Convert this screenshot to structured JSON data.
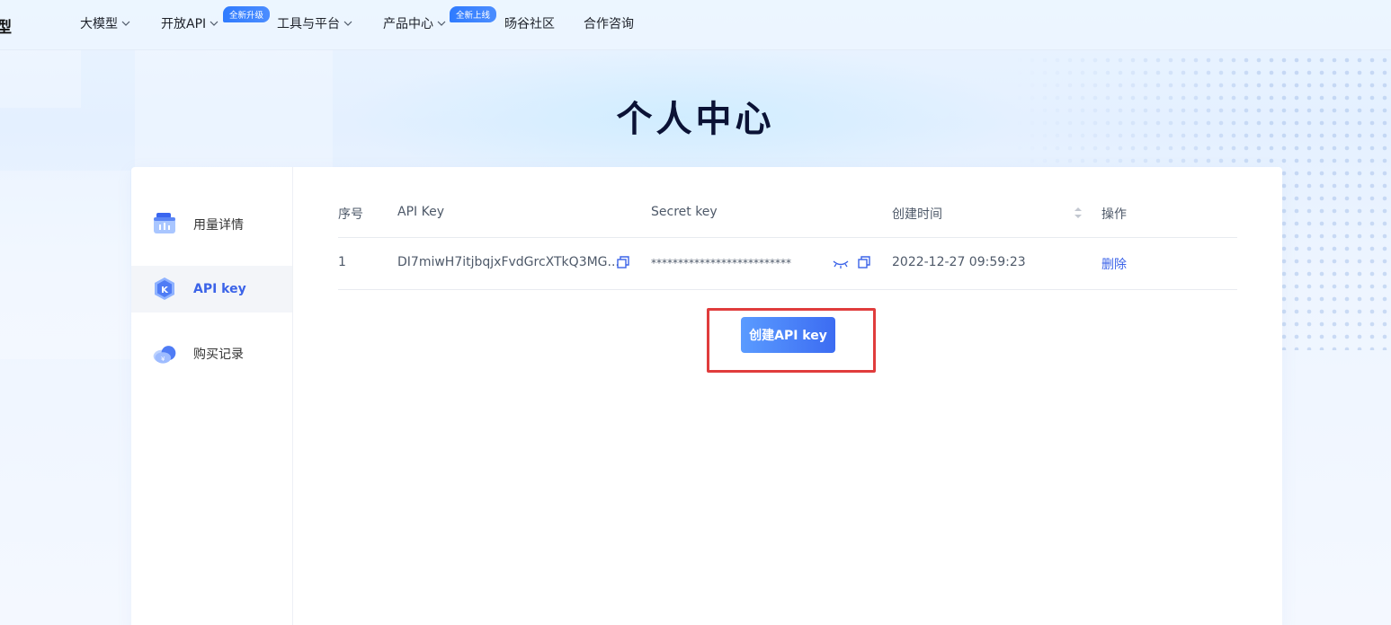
{
  "brand": "模型",
  "nav": {
    "items": [
      {
        "label": "大模型",
        "has_dropdown": true
      },
      {
        "label": "开放API",
        "has_dropdown": true,
        "badge": "全新升级"
      },
      {
        "label": "工具与平台",
        "has_dropdown": true
      },
      {
        "label": "产品中心",
        "has_dropdown": true,
        "badge": "全新上线"
      },
      {
        "label": "旸谷社区",
        "has_dropdown": false
      },
      {
        "label": "合作咨询",
        "has_dropdown": false
      }
    ]
  },
  "page": {
    "title": "个人中心"
  },
  "sidebar": {
    "items": [
      {
        "label": "用量详情",
        "icon": "usage-chart-icon",
        "active": false
      },
      {
        "label": "API key",
        "icon": "api-key-icon",
        "active": true
      },
      {
        "label": "购买记录",
        "icon": "purchase-cloud-icon",
        "active": false
      }
    ]
  },
  "table": {
    "columns": [
      "序号",
      "API Key",
      "Secret key",
      "创建时间",
      "操作"
    ],
    "rows": [
      {
        "index": "1",
        "api_key": "DI7miwH7itjbqjxFvdGrcXTkQ3MG...",
        "secret_key": "**************************",
        "created_at": "2022-12-27 09:59:23",
        "action": "删除"
      }
    ]
  },
  "create_button": {
    "label": "创建API key"
  },
  "colors": {
    "accent": "#3b63e8",
    "button_start": "#5a9bff",
    "button_end": "#3c6cf2",
    "badge": "#2f7bff",
    "highlight": "#e03c3c"
  }
}
